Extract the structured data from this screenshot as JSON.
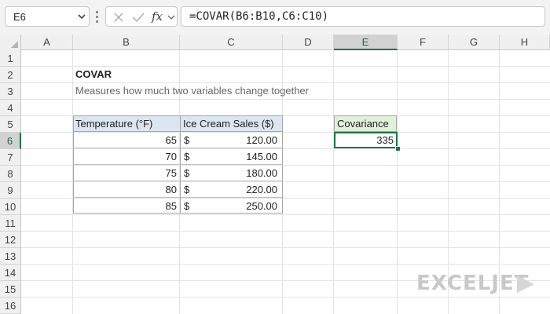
{
  "name_box": {
    "value": "E6"
  },
  "formula_bar": {
    "formula": "=COVAR(B6:B10,C6:C10)"
  },
  "columns": [
    "A",
    "B",
    "C",
    "D",
    "E",
    "F",
    "G",
    "H"
  ],
  "rows": [
    "1",
    "2",
    "3",
    "4",
    "5",
    "6",
    "7",
    "8",
    "9",
    "10",
    "11",
    "12",
    "13",
    "14",
    "15",
    "16"
  ],
  "selected": {
    "column": "E",
    "row": "6"
  },
  "sheet": {
    "title": "COVAR",
    "subtitle": "Measures how much two variables change together"
  },
  "table": {
    "headers": [
      "Temperature (°F)",
      "Ice Cream Sales ($)"
    ],
    "rows": [
      {
        "temp": "65",
        "currency": "$",
        "sales": "120.00"
      },
      {
        "temp": "70",
        "currency": "$",
        "sales": "145.00"
      },
      {
        "temp": "75",
        "currency": "$",
        "sales": "180.00"
      },
      {
        "temp": "80",
        "currency": "$",
        "sales": "220.00"
      },
      {
        "temp": "85",
        "currency": "$",
        "sales": "250.00"
      }
    ]
  },
  "result": {
    "label": "Covariance",
    "value": "335"
  },
  "brand": {
    "name": "EXCELJET"
  },
  "colors": {
    "accent": "#217346",
    "table_header": "#dce6f1",
    "result_header": "#e2efda"
  }
}
